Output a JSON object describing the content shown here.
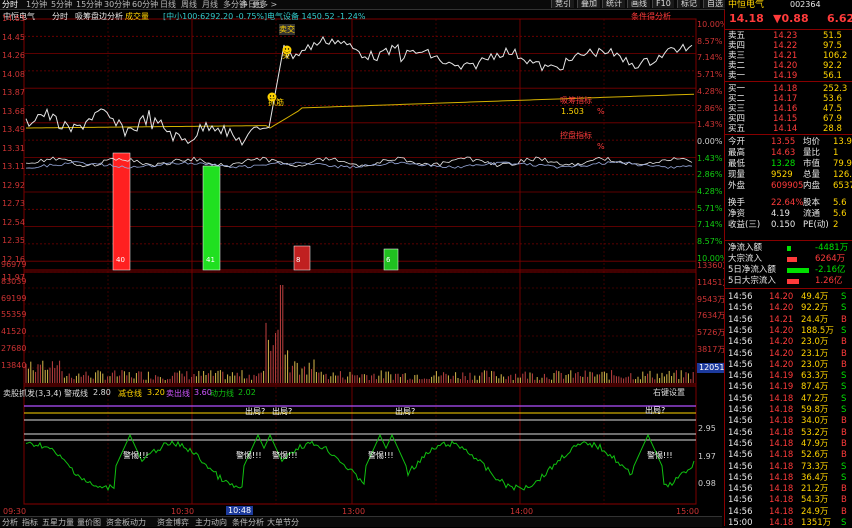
{
  "top_tabs": [
    "分时",
    "1分钟",
    "5分钟",
    "15分钟",
    "30分钟",
    "60分钟",
    "日线",
    "周线",
    "月线",
    "多分钟",
    "多日线",
    "更多 >"
  ],
  "top_tools": [
    "竞引",
    "叠加",
    "统计",
    "画线",
    "F10",
    "标记",
    "自选",
    "返回"
  ],
  "chart_header": {
    "stock": "中恒电气",
    "period": "分时",
    "indicator": "吸筹盘边分析",
    "volume_label": "成交量",
    "index_info": "[中小100:6292.20 -0.75%]",
    "sector_info": "电气设备 1450.52 -1.24%",
    "right_link": "条件得分析"
  },
  "price_axis_left": [
    "14.63",
    "14.45",
    "14.26",
    "14.08",
    "13.87",
    "13.68",
    "13.49",
    "13.31",
    "13.11",
    "12.92",
    "12.73",
    "12.54",
    "12.35",
    "12.16",
    "11.97"
  ],
  "price_axis_right": [
    "10.00%",
    "8.57%",
    "7.14%",
    "5.71%",
    "4.28%",
    "2.86%",
    "1.43%",
    "0.00%",
    "1.43%",
    "2.86%",
    "4.28%",
    "5.71%",
    "7.14%",
    "8.57%",
    "10.00%"
  ],
  "volume_axis_left": [
    "96979",
    "83039",
    "69199",
    "55359",
    "41520",
    "27680",
    "13840"
  ],
  "volume_axis_right": [
    "13360万",
    "11451万",
    "9543万",
    "7634万",
    "5726万",
    "3817万",
    "1909万"
  ],
  "volume_cursor": "12051",
  "price_annotations": {
    "tag_sell1": "卖交",
    "tag_buy": "买",
    "tag_catch": "抓筋",
    "label_a": "吸筹指标",
    "label_a_val": "1.503",
    "label_b": "控盘指标",
    "pct_marker": "%"
  },
  "bars": [
    {
      "label": "40",
      "color": "#ff2020",
      "value": 40
    },
    {
      "label": "41",
      "color": "#20e020",
      "value": 41
    },
    {
      "label": "8",
      "color": "#c02020",
      "value": 8
    },
    {
      "label": "6",
      "color": "#20c020",
      "value": 6
    }
  ],
  "indicator": {
    "title": "卖股抓发(3,3,4)",
    "warn_label": "警戒线",
    "warn_val": "2.80",
    "reduce_label": "减仓线",
    "reduce_val": "3.20",
    "sell_label": "卖出线",
    "sell_val": "3.60",
    "power_label": "动力线",
    "power_val": "2.02",
    "settings": "右键设置",
    "axis": [
      "2.95",
      "1.97",
      "0.98"
    ],
    "marks_out": [
      "出局?",
      "出局?",
      "出局?",
      "出局?"
    ],
    "marks_warn": [
      "警惕!!!",
      "警惕!!!",
      "警惕!!!",
      "警惕!!!",
      "警惕!!!"
    ]
  },
  "time_axis": [
    "09:30",
    "10:30",
    "10:48",
    "13:00",
    "14:00",
    "15:00"
  ],
  "bottom_tabs": [
    "分析",
    "指标",
    "五星力量",
    "量价图",
    "资金板动力",
    "资金博弈",
    "主力动向",
    "条件分析",
    "大单节分"
  ],
  "quote": {
    "price": "14.18",
    "change": "▼0.88",
    "pct": "6.62",
    "name": "中恒电气",
    "code": "002364",
    "sell": [
      {
        "label": "卖五",
        "price": "14.23",
        "vol": "51.5"
      },
      {
        "label": "卖四",
        "price": "14.22",
        "vol": "97.5"
      },
      {
        "label": "卖三",
        "price": "14.21",
        "vol": "106.2"
      },
      {
        "label": "卖二",
        "price": "14.20",
        "vol": "92.2"
      },
      {
        "label": "卖一",
        "price": "14.19",
        "vol": "56.1"
      }
    ],
    "buy": [
      {
        "label": "买一",
        "price": "14.18",
        "vol": "252.3"
      },
      {
        "label": "买二",
        "price": "14.17",
        "vol": "53.6"
      },
      {
        "label": "买三",
        "price": "14.16",
        "vol": "47.5"
      },
      {
        "label": "买四",
        "price": "14.15",
        "vol": "67.9"
      },
      {
        "label": "买五",
        "price": "14.14",
        "vol": "28.8"
      }
    ],
    "stats": [
      {
        "l1": "今开",
        "v1": "13.55",
        "l2": "均价",
        "v2": "13.9"
      },
      {
        "l1": "最高",
        "v1": "14.63",
        "l2": "量比",
        "v2": "1"
      },
      {
        "l1": "最低",
        "v1": "13.28",
        "l2": "市值",
        "v2": "79.9"
      },
      {
        "l1": "现量",
        "v1": "9529",
        "l2": "总量",
        "v2": "126.2"
      },
      {
        "l1": "外盘",
        "v1": "609905",
        "l2": "内盘",
        "v2": "6537"
      },
      {
        "l1": "换手",
        "v1": "22.64%",
        "l2": "股本",
        "v2": "5.6"
      },
      {
        "l1": "净资",
        "v1": "4.19",
        "l2": "流通",
        "v2": "5.6"
      },
      {
        "l1": "收益(三)",
        "v1": "0.150",
        "l2": "PE(动)",
        "v2": "2"
      }
    ],
    "flows": [
      {
        "label": "净流入额",
        "val": "-4481万",
        "color": "#00e000"
      },
      {
        "label": "大宗流入",
        "val": "6264万",
        "color": "#ff3b3b"
      },
      {
        "label": "5日净流入额",
        "val": "-2.16亿",
        "color": "#00e000"
      },
      {
        "label": "5日大宗流入",
        "val": "1.26亿",
        "color": "#ff3b3b"
      }
    ],
    "ticks": [
      {
        "t": "14:56",
        "p": "14.20",
        "v": "49.4万",
        "s": "S"
      },
      {
        "t": "14:56",
        "p": "14.20",
        "v": "92.2万",
        "s": "S"
      },
      {
        "t": "14:56",
        "p": "14.21",
        "v": "24.4万",
        "s": "B"
      },
      {
        "t": "14:56",
        "p": "14.20",
        "v": "188.5万",
        "s": "S"
      },
      {
        "t": "14:56",
        "p": "14.20",
        "v": "23.0万",
        "s": "B"
      },
      {
        "t": "14:56",
        "p": "14.20",
        "v": "23.1万",
        "s": "B"
      },
      {
        "t": "14:56",
        "p": "14.20",
        "v": "23.0万",
        "s": "B"
      },
      {
        "t": "14:56",
        "p": "14.19",
        "v": "63.3万",
        "s": "S"
      },
      {
        "t": "14:56",
        "p": "14.19",
        "v": "87.4万",
        "s": "S"
      },
      {
        "t": "14:56",
        "p": "14.18",
        "v": "47.2万",
        "s": "S"
      },
      {
        "t": "14:56",
        "p": "14.18",
        "v": "59.8万",
        "s": "S"
      },
      {
        "t": "14:56",
        "p": "14.18",
        "v": "34.0万",
        "s": "B"
      },
      {
        "t": "14:56",
        "p": "14.18",
        "v": "53.2万",
        "s": "B"
      },
      {
        "t": "14:56",
        "p": "14.18",
        "v": "47.9万",
        "s": "B"
      },
      {
        "t": "14:56",
        "p": "14.18",
        "v": "52.6万",
        "s": "B"
      },
      {
        "t": "14:56",
        "p": "14.18",
        "v": "73.3万",
        "s": "S"
      },
      {
        "t": "14:56",
        "p": "14.18",
        "v": "36.4万",
        "s": "S"
      },
      {
        "t": "14:56",
        "p": "14.18",
        "v": "21.2万",
        "s": "B"
      },
      {
        "t": "14:56",
        "p": "14.18",
        "v": "54.3万",
        "s": "B"
      },
      {
        "t": "14:56",
        "p": "14.18",
        "v": "24.9万",
        "s": "B"
      },
      {
        "t": "15:00",
        "p": "14.18",
        "v": "1351万",
        "s": "S"
      }
    ]
  }
}
